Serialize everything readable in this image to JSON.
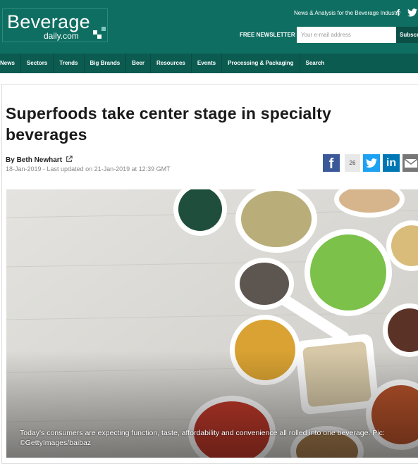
{
  "header": {
    "logo_main": "Beverage",
    "logo_sub": "daily.com",
    "tagline": "News & Analysis for the Beverage Industry",
    "newsletter_label": "FREE NEWSLETTER",
    "email_placeholder": "Your e-mail address",
    "subscribe_label": "Subscr",
    "brand_color": "#0f6e62"
  },
  "nav": {
    "items": [
      "News",
      "Sectors",
      "Trends",
      "Big Brands",
      "Beer",
      "Resources",
      "Events",
      "Processing & Packaging",
      "Search"
    ]
  },
  "article": {
    "headline": "Superfoods take center stage in specialty beverages",
    "author_prefix": "By",
    "author": "Beth Newhart",
    "dateline": "18-Jan-2019 - Last updated on 21-Jan-2019 at 12:39 GMT",
    "share_count": "26",
    "caption": "Today's consumers are expecting function, taste, affordability and convenience all rolled into one beverage. Pic: ©GettyImages/baibaz"
  },
  "icons": {
    "facebook": "facebook-icon",
    "twitter": "twitter-icon",
    "linkedin": "linkedin-icon",
    "email": "email-icon",
    "external": "external-link-icon"
  }
}
